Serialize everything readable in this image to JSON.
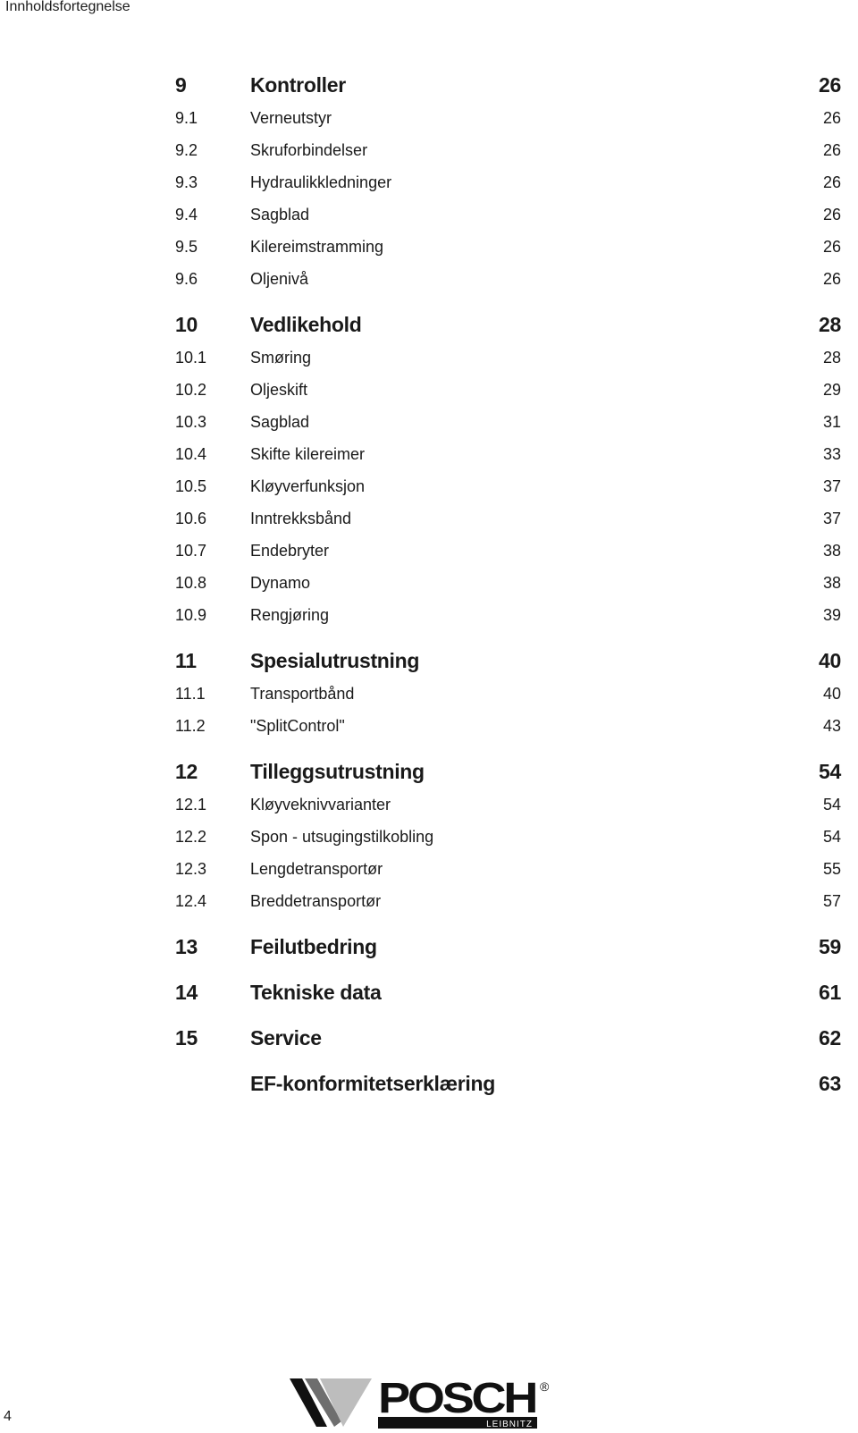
{
  "running_head": "Innholdsfortegnelse",
  "toc": {
    "chapters": [
      {
        "num": "9",
        "title": "Kontroller",
        "page": "26",
        "sections": [
          {
            "num": "9.1",
            "title": "Verneutstyr",
            "page": "26"
          },
          {
            "num": "9.2",
            "title": "Skruforbindelser",
            "page": "26"
          },
          {
            "num": "9.3",
            "title": "Hydraulikkledninger",
            "page": "26"
          },
          {
            "num": "9.4",
            "title": "Sagblad",
            "page": "26"
          },
          {
            "num": "9.5",
            "title": "Kilereimstramming",
            "page": "26"
          },
          {
            "num": "9.6",
            "title": "Oljenivå",
            "page": "26"
          }
        ]
      },
      {
        "num": "10",
        "title": "Vedlikehold",
        "page": "28",
        "sections": [
          {
            "num": "10.1",
            "title": "Smøring",
            "page": "28"
          },
          {
            "num": "10.2",
            "title": "Oljeskift",
            "page": "29"
          },
          {
            "num": "10.3",
            "title": "Sagblad",
            "page": "31"
          },
          {
            "num": "10.4",
            "title": "Skifte kilereimer",
            "page": "33"
          },
          {
            "num": "10.5",
            "title": "Kløyverfunksjon",
            "page": "37"
          },
          {
            "num": "10.6",
            "title": "Inntrekksbånd",
            "page": "37"
          },
          {
            "num": "10.7",
            "title": "Endebryter",
            "page": "38"
          },
          {
            "num": "10.8",
            "title": "Dynamo",
            "page": "38"
          },
          {
            "num": "10.9",
            "title": "Rengjøring",
            "page": "39"
          }
        ]
      },
      {
        "num": "11",
        "title": "Spesialutrustning",
        "page": "40",
        "sections": [
          {
            "num": "11.1",
            "title": "Transportbånd",
            "page": "40"
          },
          {
            "num": "11.2",
            "title": "\"SplitControl\"",
            "page": "43"
          }
        ]
      },
      {
        "num": "12",
        "title": "Tilleggsutrustning",
        "page": "54",
        "sections": [
          {
            "num": "12.1",
            "title": "Kløyveknivvarianter",
            "page": "54"
          },
          {
            "num": "12.2",
            "title": "Spon - utsugingstilkobling",
            "page": "54"
          },
          {
            "num": "12.3",
            "title": "Lengdetransportør",
            "page": "55"
          },
          {
            "num": "12.4",
            "title": "Breddetransportør",
            "page": "57"
          }
        ]
      },
      {
        "num": "13",
        "title": "Feilutbedring",
        "page": "59",
        "sections": []
      },
      {
        "num": "14",
        "title": "Tekniske data",
        "page": "61",
        "sections": []
      },
      {
        "num": "15",
        "title": "Service",
        "page": "62",
        "sections": []
      },
      {
        "num": "",
        "title": "EF-konformitetserklæring",
        "page": "63",
        "sections": []
      }
    ]
  },
  "footer": {
    "page_number": "4",
    "logo": {
      "brand": "POSCH",
      "subtitle": "LEIBNITZ",
      "registered_mark": "®"
    }
  }
}
